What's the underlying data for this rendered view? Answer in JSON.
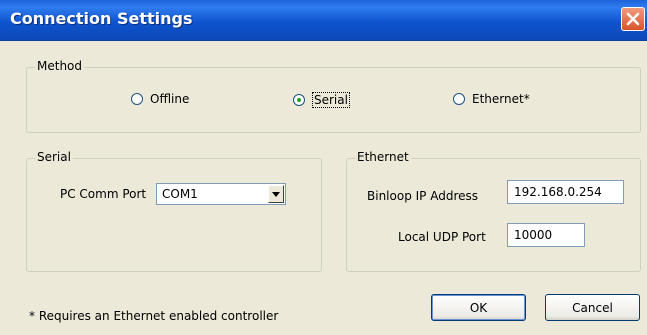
{
  "window": {
    "title": "Connection Settings"
  },
  "method": {
    "legend": "Method",
    "options": [
      {
        "label": "Offline",
        "selected": false
      },
      {
        "label": "Serial",
        "selected": true
      },
      {
        "label": "Ethernet*",
        "selected": false
      }
    ]
  },
  "serial": {
    "legend": "Serial",
    "port_label": "PC Comm Port",
    "port_value": "COM1"
  },
  "ethernet": {
    "legend": "Ethernet",
    "ip_label": "Binloop IP Address",
    "ip_value": "192.168.0.254",
    "udp_label": "Local UDP Port",
    "udp_value": "10000"
  },
  "footnote": "* Requires an Ethernet enabled controller",
  "buttons": {
    "ok": "OK",
    "cancel": "Cancel"
  },
  "colors": {
    "titlebar": "#0f54cf",
    "dialog_bg": "#ece9d8",
    "radio_dot": "#21a121"
  }
}
